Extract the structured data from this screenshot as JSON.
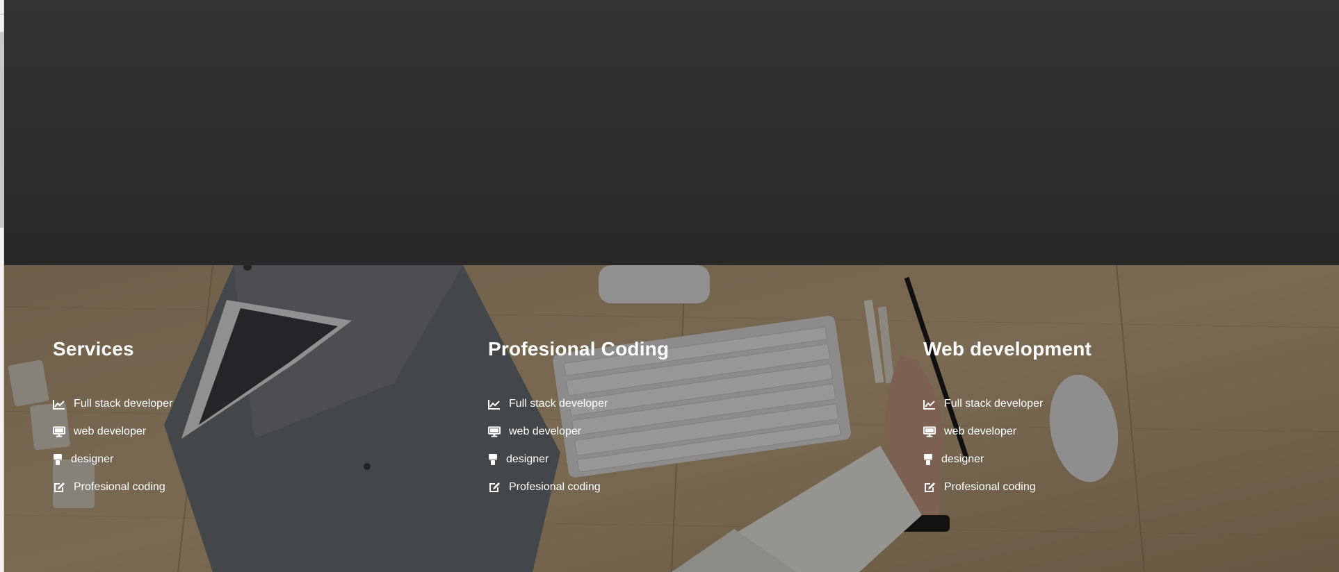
{
  "columns": [
    {
      "heading": "Services",
      "items": [
        {
          "label": "Full stack developer",
          "icon": "line-chart-icon"
        },
        {
          "label": "web developer",
          "icon": "desktop-icon"
        },
        {
          "label": "designer",
          "icon": "paint-brush-icon"
        },
        {
          "label": "Profesional coding",
          "icon": "edit-icon"
        }
      ]
    },
    {
      "heading": "Profesional Coding",
      "items": [
        {
          "label": "Full stack developer",
          "icon": "line-chart-icon"
        },
        {
          "label": "web developer",
          "icon": "desktop-icon"
        },
        {
          "label": "designer",
          "icon": "paint-brush-icon"
        },
        {
          "label": "Profesional coding",
          "icon": "edit-icon"
        }
      ]
    },
    {
      "heading": "Web development",
      "items": [
        {
          "label": "Full stack developer",
          "icon": "line-chart-icon"
        },
        {
          "label": "web developer",
          "icon": "desktop-icon"
        },
        {
          "label": "designer",
          "icon": "paint-brush-icon"
        },
        {
          "label": "Profesional coding",
          "icon": "edit-icon"
        }
      ]
    }
  ],
  "colors": {
    "top_band": "#2e2e2e",
    "text": "#ffffff",
    "overlay": "rgba(0,0,0,0.38)"
  }
}
